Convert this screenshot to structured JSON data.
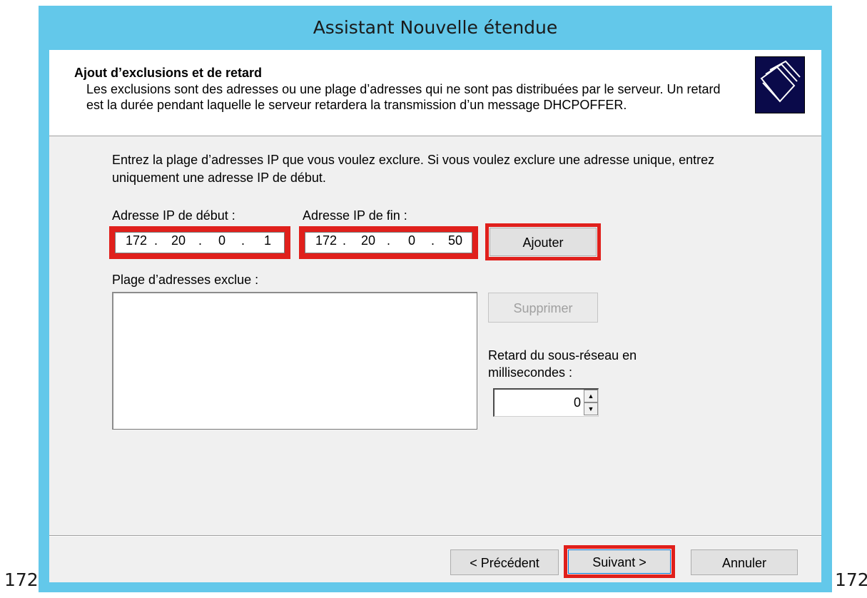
{
  "window": {
    "title": "Assistant Nouvelle étendue"
  },
  "header": {
    "title": "Ajout d’exclusions et de retard",
    "description": "Les exclusions sont des adresses ou une plage d’adresses qui ne sont pas distribuées par le serveur. Un retard est la durée pendant laquelle le serveur retardera la transmission d’un message DHCPOFFER.",
    "icon": "folders-icon"
  },
  "form": {
    "intro": "Entrez la plage d’adresses IP que vous voulez exclure. Si vous voulez exclure une adresse unique, entrez uniquement une adresse IP de début.",
    "start_label": "Adresse IP de début :",
    "end_label": "Adresse IP de fin :",
    "start_ip": {
      "o1": "172",
      "o2": "20",
      "o3": "0",
      "o4": "1"
    },
    "end_ip": {
      "o1": "172",
      "o2": "20",
      "o3": "0",
      "o4": "50"
    },
    "dot": ".",
    "add_button": "Ajouter",
    "excluded_label": "Plage d’adresses exclue :",
    "remove_button": "Supprimer",
    "delay_label": "Retard du sous-réseau en millisecondes :",
    "delay_value": "0"
  },
  "footer": {
    "back_button": "< Précédent",
    "next_button": "Suivant >",
    "cancel_button": "Annuler"
  },
  "page_labels": {
    "left": "172",
    "right": "172"
  },
  "colors": {
    "titlebar": "#63c8ea",
    "highlight": "#e0201c",
    "client_bg": "#f0f0f0"
  }
}
